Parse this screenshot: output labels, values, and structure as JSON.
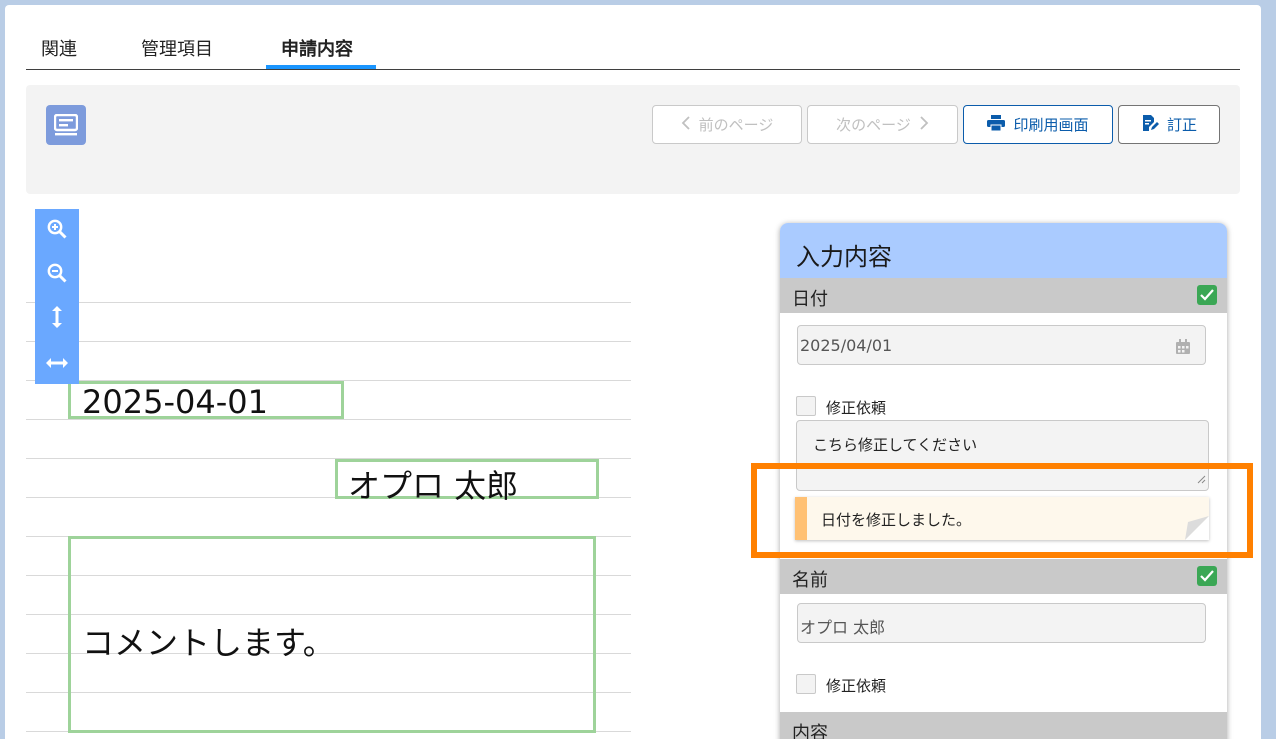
{
  "tabs": [
    "関連",
    "管理項目",
    "申請内容"
  ],
  "active_tab": "申請内容",
  "toolbar": {
    "prev_label": "前のページ",
    "next_label": "次のページ",
    "print_label": "印刷用画面",
    "fix_label": "訂正"
  },
  "document": {
    "date": "2025-04-01",
    "name": "オプロ 太郎",
    "comment": "コメントします。"
  },
  "panel": {
    "title": "入力内容",
    "sections": [
      {
        "label": "日付",
        "value": "2025/04/01",
        "checkbox_label": "修正依頼",
        "request_text": "こちら修正してください",
        "note": "日付を修正しました。"
      },
      {
        "label": "名前",
        "value": "オプロ 太郎",
        "checkbox_label": "修正依頼"
      },
      {
        "label": "内容"
      }
    ]
  },
  "colors": {
    "accent": "#1b96ff",
    "panel_header": "#aacbff",
    "highlight": "#ff8000",
    "field_box": "#9ed39a",
    "check": "#3ba755"
  }
}
